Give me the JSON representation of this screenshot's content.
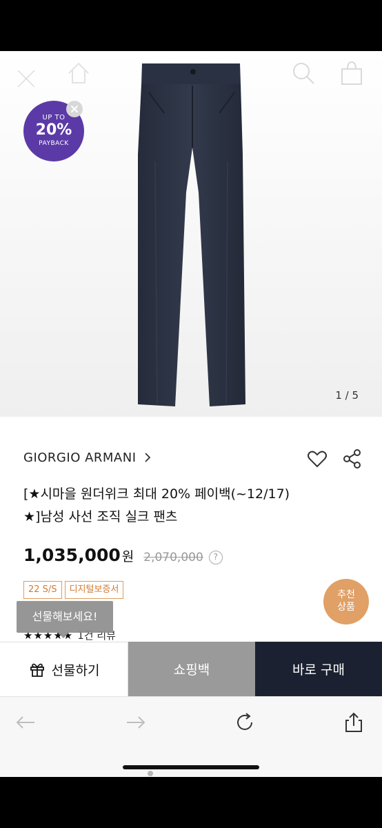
{
  "hero": {
    "badge": {
      "line1": "UP TO",
      "line2": "20%",
      "line3": "PAYBACK"
    },
    "pager": "1 / 5"
  },
  "product": {
    "brand": "GIORGIO ARMANI",
    "title_line1": "[★시마을 원더위크 최대 20% 페이백(~12/17)",
    "title_line2": "★]남성 사선 조직 실크 팬츠",
    "price": "1,035,000",
    "currency": "원",
    "original_price": "2,070,000",
    "help": "?",
    "tags": [
      "22 S/S",
      "디지털보증서"
    ],
    "recommend": {
      "line1": "추천",
      "line2": "상품"
    },
    "gift_tooltip": "선물해보세요!",
    "stars": "★★★★★",
    "review": "1건 리뷰"
  },
  "buttons": {
    "gift": "선물하기",
    "bag": "쇼핑백",
    "buy": "바로 구매"
  },
  "colors": {
    "badge": "#5b3aa7",
    "tag": "#d07a34",
    "recommend": "#e0a066",
    "buy_button": "#1b2130",
    "bag_button": "#9a9a9a"
  }
}
